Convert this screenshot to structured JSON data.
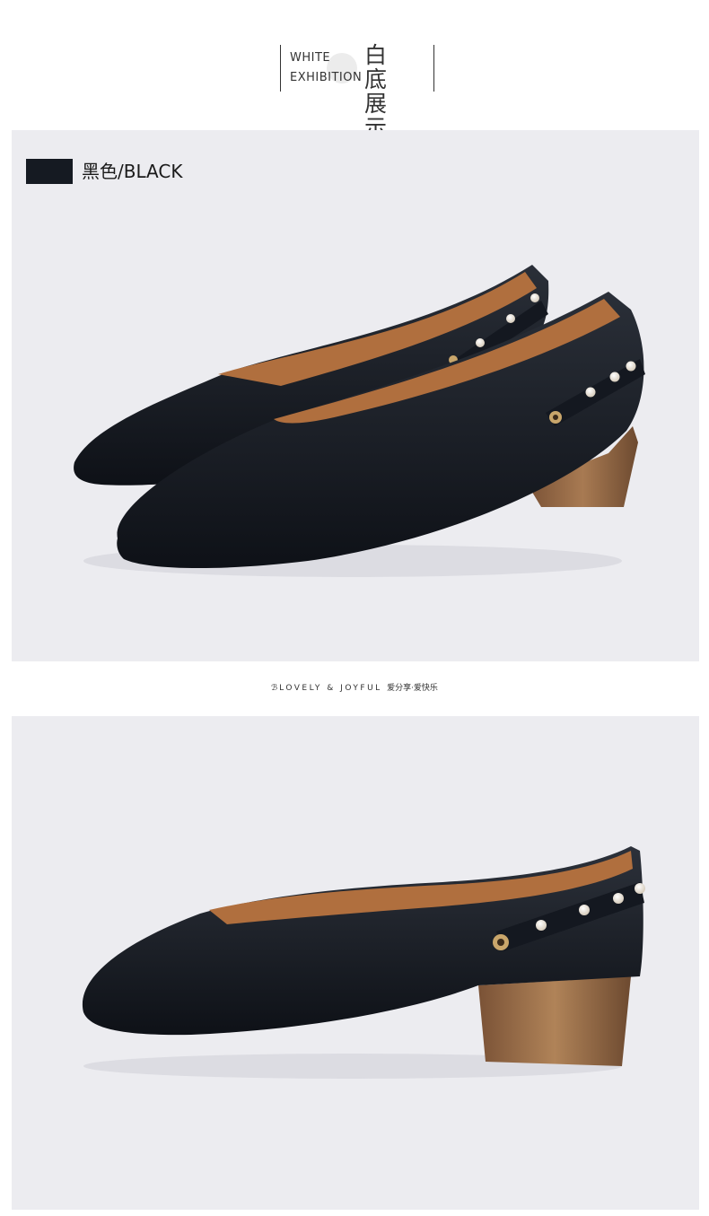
{
  "header": {
    "en_line1": "WHITE",
    "en_line2": "EXHIBITION",
    "zh_line1": "白 底",
    "zh_line2": "展 示"
  },
  "color_option": {
    "label": "黑色/BLACK",
    "swatch_color": "#151a22"
  },
  "tagline": {
    "mark": "ℬ",
    "text": "LOVELY & JOYFUL",
    "cn": "爱分享·爱快乐"
  },
  "colors": {
    "panel_bg": "#ececf0",
    "leather": "#141820",
    "lining": "#b06f3e",
    "heel_wood": "#9a6a44"
  }
}
